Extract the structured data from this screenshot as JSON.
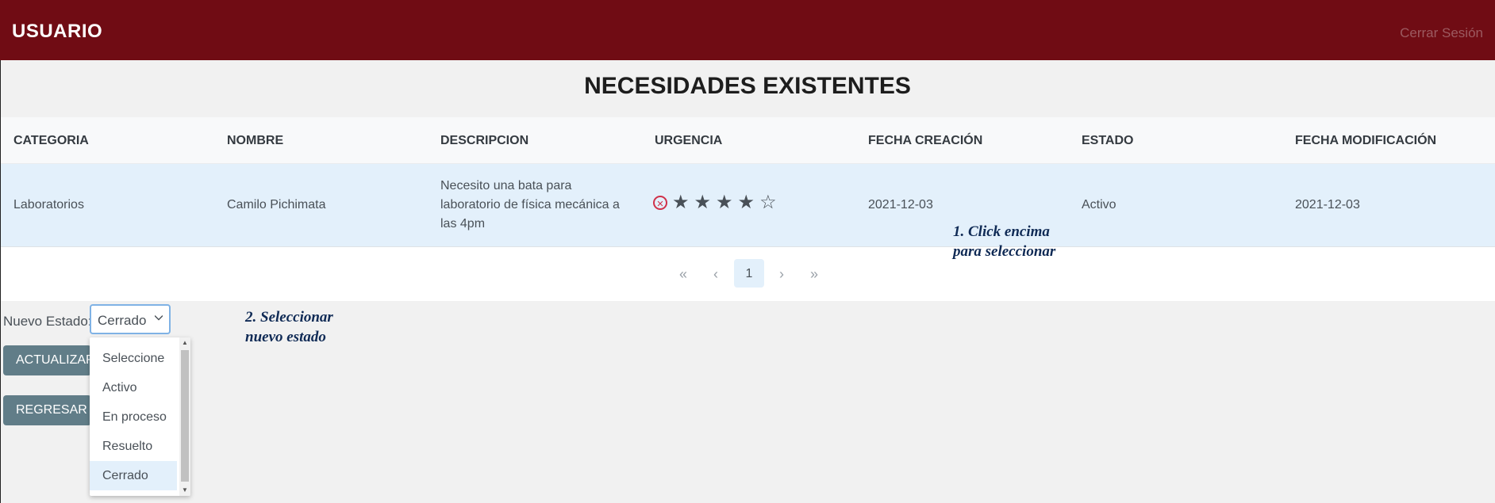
{
  "header": {
    "brand": "USUARIO",
    "logout": "Cerrar Sesión",
    "background": "#700c14"
  },
  "page": {
    "title": "NECESIDADES EXISTENTES"
  },
  "table": {
    "columns": [
      "CATEGORIA",
      "NOMBRE",
      "DESCRIPCION",
      "URGENCIA",
      "FECHA CREACIÓN",
      "ESTADO",
      "FECHA MODIFICACIÓN"
    ],
    "row": {
      "categoria": "Laboratorios",
      "nombre": "Camilo Pichimata",
      "descripcion": [
        "Necesito una bata para",
        "laboratorio de física mecánica a",
        "las 4pm"
      ],
      "urgencia_rating": 4,
      "urgencia_max": 5,
      "fecha_creacion": "2021-12-03",
      "estado": "Activo",
      "fecha_modificacion": "2021-12-03"
    }
  },
  "pager": {
    "first": "«",
    "prev": "‹",
    "page": "1",
    "next": "›",
    "last": "»"
  },
  "annotations": {
    "step1": [
      "1. Click encima",
      "para seleccionar"
    ],
    "step2": [
      "2. Seleccionar",
      "nuevo estado"
    ]
  },
  "form": {
    "estado_label": "Nuevo Estado:",
    "selected": "Cerrado",
    "options": [
      "Seleccione",
      "Activo",
      "En proceso",
      "Resuelto",
      "Cerrado"
    ],
    "update_button": "ACTUALIZAR",
    "back_button": "REGRESAR"
  },
  "icons": {
    "cancel": "cancel-circle-icon",
    "star_filled": "star-filled-icon",
    "star_empty": "star-outline-icon",
    "chevron": "chevron-down-icon"
  }
}
